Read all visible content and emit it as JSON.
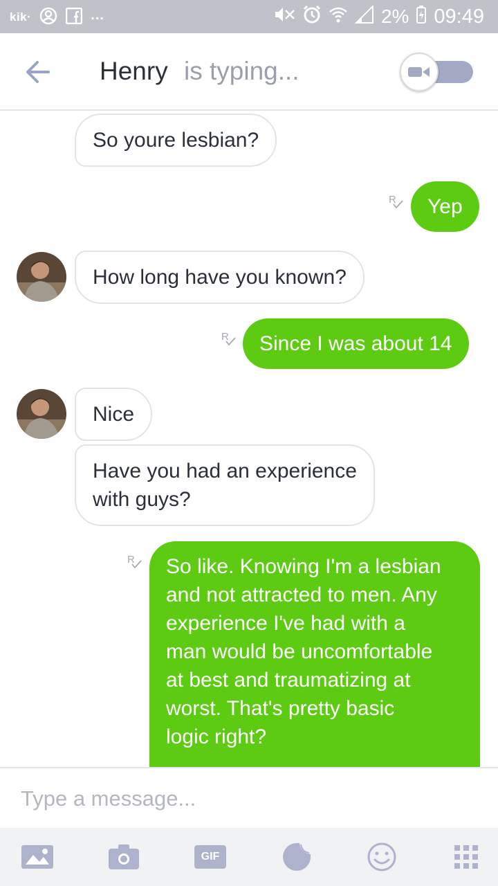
{
  "status_bar": {
    "left": {
      "app": "kik·",
      "dots": "..."
    },
    "right": {
      "battery": "2%",
      "time": "09:49"
    }
  },
  "header": {
    "contact_name": "Henry",
    "status": "is typing...",
    "back_icon": "arrow-left-icon",
    "video_icon": "video-camera-icon"
  },
  "messages": [
    {
      "side": "incoming",
      "text": "So youre lesbian?",
      "avatar": false
    },
    {
      "side": "outgoing",
      "text": "Yep",
      "receipt": "R"
    },
    {
      "side": "incoming",
      "text": "How long have you known?",
      "avatar": true
    },
    {
      "side": "outgoing",
      "text": "Since I was about 14",
      "receipt": "R"
    },
    {
      "side": "incoming",
      "text": "Nice",
      "avatar": true
    },
    {
      "side": "incoming",
      "text": "Have you had an experience\nwith guys?",
      "avatar": false
    },
    {
      "side": "outgoing",
      "text": "So like. Knowing I'm a lesbian\nand not attracted to men. Any\nexperience I've had with a\nman would be uncomfortable\nat best and traumatizing at\nworst. That's pretty basic\nlogic right?",
      "receipt": "R"
    }
  ],
  "composer": {
    "placeholder": "Type a message..."
  },
  "toolbar": {
    "gallery_icon": "image-icon",
    "camera_icon": "camera-icon",
    "gif_label": "GIF",
    "sticker_icon": "sticker-icon",
    "emoji_icon": "smiley-icon",
    "apps_icon": "grid-icon"
  },
  "colors": {
    "outgoing_bubble": "#5dcb12",
    "status_bar": "#bfc2c9",
    "accent": "#a4a9c3"
  }
}
